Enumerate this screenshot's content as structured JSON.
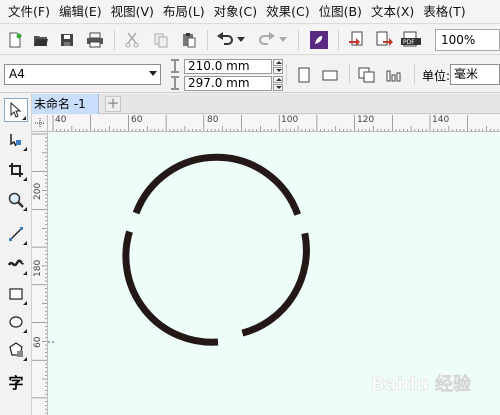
{
  "menubar": {
    "items": [
      {
        "label": "文件(F)"
      },
      {
        "label": "编辑(E)"
      },
      {
        "label": "视图(V)"
      },
      {
        "label": "布局(L)"
      },
      {
        "label": "对象(C)"
      },
      {
        "label": "效果(C)"
      },
      {
        "label": "位图(B)"
      },
      {
        "label": "文本(X)"
      },
      {
        "label": "表格(T)"
      }
    ]
  },
  "toolbar": {
    "zoom": "100%",
    "icons": [
      "new-icon",
      "open-icon",
      "save-icon",
      "print-icon",
      "cut-icon",
      "copy-icon",
      "paste-icon",
      "undo-icon",
      "redo-icon",
      "app-launcher-icon",
      "import-icon",
      "export-icon",
      "publish-pdf-icon"
    ]
  },
  "property_bar": {
    "paper_size": "A4",
    "width": "210.0 mm",
    "height": "297.0 mm",
    "unit_label": "单位:",
    "unit_value": "毫米"
  },
  "toolbox": {
    "tools": [
      "pick-tool",
      "shape-tool",
      "crop-tool",
      "zoom-tool",
      "freehand-tool",
      "artistic-media-tool",
      "rectangle-tool",
      "ellipse-tool",
      "polygon-tool",
      "text-tool"
    ],
    "text_tool_label": "字"
  },
  "document": {
    "tab_title": "未命名 -1",
    "add_tab": "+"
  },
  "rulers": {
    "horizontal_labels": [
      "40",
      "60",
      "80",
      "100",
      "120",
      "140"
    ],
    "vertical_labels": [
      "200",
      "180",
      "60"
    ]
  },
  "colors": {
    "canvas_bg": "#effdf9",
    "shape_stroke": "#231815",
    "active_tab": "#c9defa"
  },
  "watermark": "Baidu 经验"
}
